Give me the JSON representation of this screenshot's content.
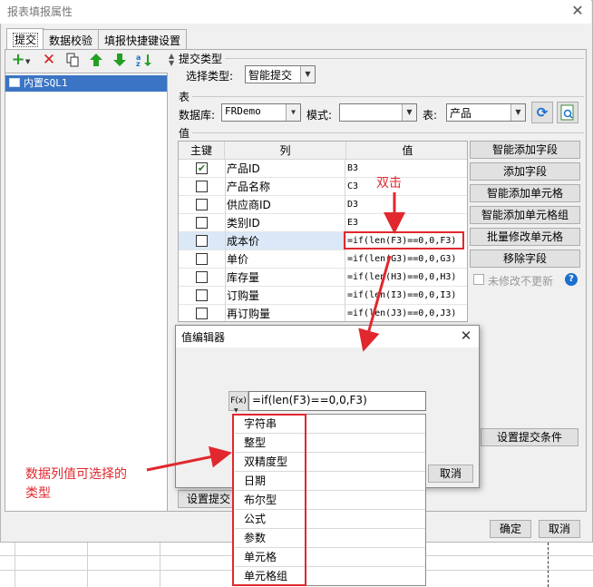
{
  "window": {
    "title": "报表填报属性",
    "close": "✕"
  },
  "tabs": [
    "提交",
    "数据校验",
    "填报快捷键设置"
  ],
  "left_panel": {
    "items": [
      "内置SQL1"
    ]
  },
  "submit_type": {
    "section": "提交类型",
    "label": "选择类型:",
    "value": "智能提交"
  },
  "table": {
    "section": "表",
    "db_label": "数据库:",
    "db_value": "FRDemo",
    "schema_label": "模式:",
    "schema_value": "",
    "table_label": "表:",
    "table_value": "产品"
  },
  "values": {
    "section": "值",
    "headers": [
      "主键",
      "列",
      "值"
    ],
    "rows": [
      {
        "key": true,
        "col": "产品ID",
        "val": "B3"
      },
      {
        "key": false,
        "col": "产品名称",
        "val": "C3"
      },
      {
        "key": false,
        "col": "供应商ID",
        "val": "D3"
      },
      {
        "key": false,
        "col": "类别ID",
        "val": "E3"
      },
      {
        "key": false,
        "col": "成本价",
        "val": "=if(len(F3)==0,0,F3)"
      },
      {
        "key": false,
        "col": "单价",
        "val": "=if(len(G3)==0,0,G3)"
      },
      {
        "key": false,
        "col": "库存量",
        "val": "=if(len(H3)==0,0,H3)"
      },
      {
        "key": false,
        "col": "订购量",
        "val": "=if(len(I3)==0,0,I3)"
      },
      {
        "key": false,
        "col": "再订购量",
        "val": "=if(len(J3)==0,0,J3)"
      }
    ]
  },
  "side_buttons": [
    "智能添加字段",
    "添加字段",
    "智能添加单元格",
    "智能添加单元格组",
    "批量修改单元格",
    "移除字段"
  ],
  "no_update_checkbox": "未修改不更新",
  "set_condition_button": "设置提交条件",
  "set_submit_button": "设置提交",
  "footer": {
    "ok": "确定",
    "cancel": "取消"
  },
  "value_editor": {
    "title": "值编辑器",
    "fx_label": "F(x)",
    "formula": "=if(len(F3)==0,0,F3)",
    "cancel": "取消",
    "type_options": [
      "字符串",
      "整型",
      "双精度型",
      "日期",
      "布尔型",
      "公式",
      "参数",
      "单元格",
      "单元格组"
    ]
  },
  "annotations": {
    "double_click": "双击",
    "types_note_line1": "数据列值可选择的",
    "types_note_line2": "类型",
    "color": "#e0282e"
  }
}
